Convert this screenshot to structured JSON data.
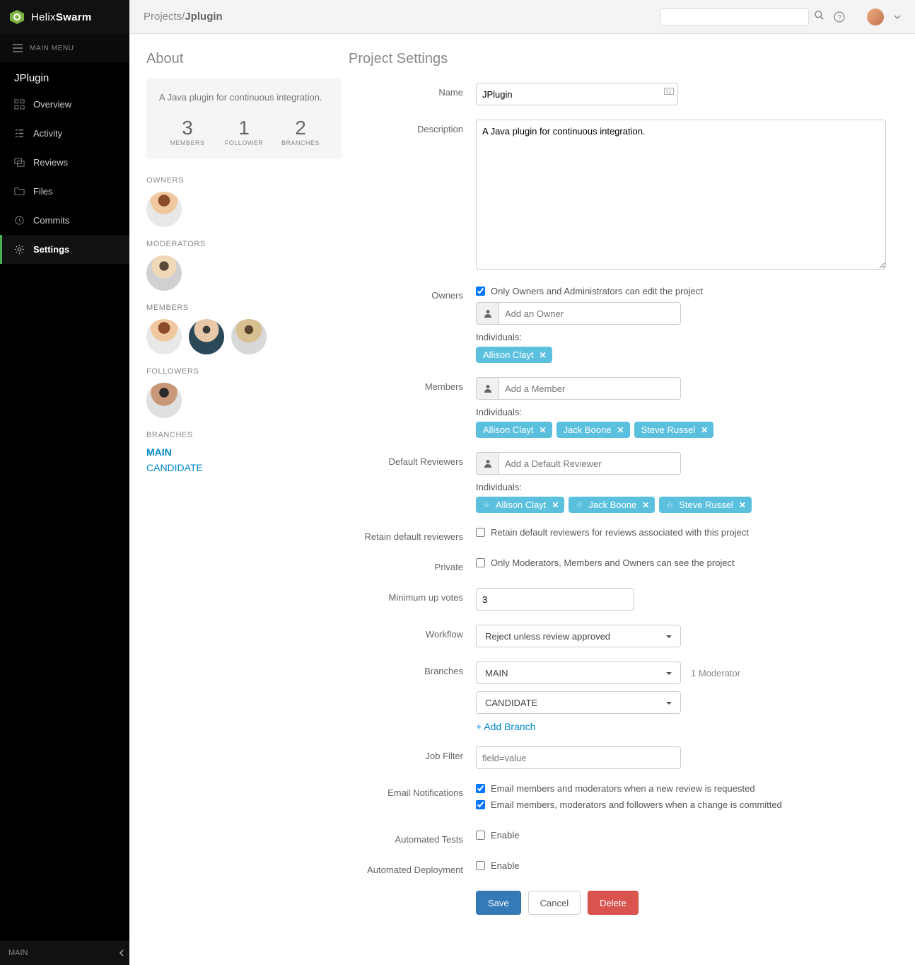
{
  "brand": {
    "part1": "Helix",
    "part2": "Swarm"
  },
  "mainmenu_label": "MAIN MENU",
  "project_title": "JPlugin",
  "nav": {
    "overview": "Overview",
    "activity": "Activity",
    "reviews": "Reviews",
    "files": "Files",
    "commits": "Commits",
    "settings": "Settings"
  },
  "sidebar_footer": "MAIN",
  "breadcrumb": {
    "root": "Projects/",
    "current": "Jplugin"
  },
  "about": {
    "heading": "About",
    "desc": "A Java plugin for continuous integration.",
    "stats": {
      "members_num": "3",
      "members_lbl": "MEMBERS",
      "follower_num": "1",
      "follower_lbl": "FOLLOWER",
      "branches_num": "2",
      "branches_lbl": "BRANCHES"
    }
  },
  "side": {
    "owners": "OWNERS",
    "moderators": "MODERATORS",
    "members": "MEMBERS",
    "followers": "FOLLOWERS",
    "branches": "BRANCHES",
    "branch_links": {
      "main": "MAIN",
      "candidate": "CANDIDATE"
    }
  },
  "form": {
    "heading": "Project Settings",
    "name_lbl": "Name",
    "name_val": "JPlugin",
    "desc_lbl": "Description",
    "desc_val": "A Java plugin for continuous integration.",
    "owners_lbl": "Owners",
    "owners_check": "Only Owners and Administrators can edit the project",
    "add_owner_ph": "Add an Owner",
    "individuals": "Individuals:",
    "owner_tags": {
      "t0": "Allison Clayt"
    },
    "members_lbl": "Members",
    "add_member_ph": "Add a Member",
    "member_tags": {
      "t0": "Allison Clayt",
      "t1": "Jack Boone",
      "t2": "Steve Russel"
    },
    "defrev_lbl": "Default Reviewers",
    "add_defrev_ph": "Add a Default Reviewer",
    "defrev_tags": {
      "t0": "Allison Clayt",
      "t1": "Jack Boone",
      "t2": "Steve Russel"
    },
    "retain_lbl": "Retain default reviewers",
    "retain_check": "Retain default reviewers for reviews associated with this project",
    "private_lbl": "Private",
    "private_check": "Only Moderators, Members and Owners can see the project",
    "minvotes_lbl": "Minimum up votes",
    "minvotes_val": "3",
    "workflow_lbl": "Workflow",
    "workflow_val": "Reject unless review approved",
    "branches_lbl": "Branches",
    "branch_main": "MAIN",
    "branch_main_mod": "1 Moderator",
    "branch_candidate": "CANDIDATE",
    "add_branch": "+ Add Branch",
    "jobfilter_lbl": "Job Filter",
    "jobfilter_ph": "field=value",
    "email_lbl": "Email Notifications",
    "email_check1": "Email members and moderators when a new review is requested",
    "email_check2": "Email members, moderators and followers when a change is committed",
    "autotest_lbl": "Automated Tests",
    "autodep_lbl": "Automated Deployment",
    "enable": "Enable",
    "save": "Save",
    "cancel": "Cancel",
    "delete": "Delete"
  }
}
